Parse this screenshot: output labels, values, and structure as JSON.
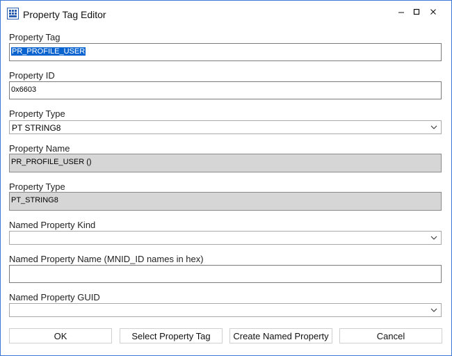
{
  "window": {
    "title": "Property Tag Editor",
    "icon": "grid-app-icon",
    "controls": [
      "minimize-icon",
      "maximize-icon",
      "close-icon"
    ]
  },
  "fields": {
    "property_tag": {
      "label": "Property Tag",
      "value": "PR_PROFILE_USER"
    },
    "property_id": {
      "label": "Property ID",
      "value": "0x6603"
    },
    "property_type_select": {
      "label": "Property Type",
      "value": "PT STRING8"
    },
    "property_name": {
      "label": "Property Name",
      "value": "PR_PROFILE_USER ()"
    },
    "property_type_display": {
      "label": "Property Type",
      "value": "PT_STRING8"
    },
    "named_property_kind": {
      "label": "Named Property Kind",
      "value": ""
    },
    "named_property_name": {
      "label": "Named Property Name (MNID_ID names in hex)",
      "value": ""
    },
    "named_property_guid": {
      "label": "Named Property GUID",
      "value": ""
    }
  },
  "buttons": {
    "ok": "OK",
    "select_tag": "Select Property Tag",
    "create_named": "Create Named Property",
    "cancel": "Cancel"
  },
  "colors": {
    "window_border": "#3b78d8",
    "selection": "#0a64d0",
    "readonly_bg": "#d6d6d6"
  }
}
